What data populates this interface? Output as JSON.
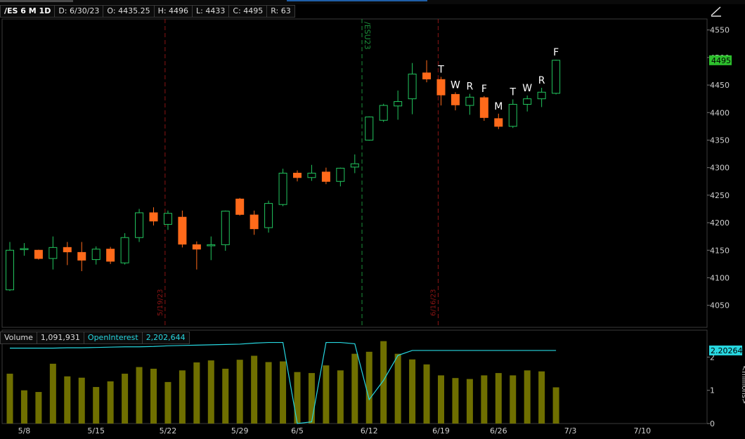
{
  "header": {
    "symbol": "/ES 6 M 1D",
    "date": "D: 6/30/23",
    "open": "O: 4435.25",
    "high": "H: 4496",
    "low": "L: 4433",
    "close": "C: 4495",
    "range": "R: 63"
  },
  "volume_header": {
    "volume_label": "Volume",
    "volume_value": "1,091,931",
    "oi_label": "OpenInterest",
    "oi_value": "2,202,644"
  },
  "colors": {
    "up": "#22c55e",
    "down": "#ff6a1a",
    "volume": "#6f6f00",
    "open_interest": "#27d7e0",
    "price_badge": "#2dc02d",
    "expiry_line": "#1b8f3a",
    "marker_line": "#8a1414"
  },
  "chart_data": [
    {
      "type": "candlestick",
      "ylim": [
        4010,
        4570
      ],
      "yticks": [
        4050,
        4100,
        4150,
        4200,
        4250,
        4300,
        4350,
        4400,
        4450,
        4500,
        4550
      ],
      "xticks": [
        {
          "label": "5/8",
          "index": 1
        },
        {
          "label": "5/15",
          "index": 6
        },
        {
          "label": "5/22",
          "index": 11
        },
        {
          "label": "5/29",
          "index": 16
        },
        {
          "label": "6/5",
          "index": 20
        },
        {
          "label": "6/12",
          "index": 25
        },
        {
          "label": "6/19",
          "index": 30
        },
        {
          "label": "6/26",
          "index": 34
        },
        {
          "label": "7/3",
          "index": 39
        },
        {
          "label": "7/10",
          "index": 44
        }
      ],
      "last_price": "4495",
      "candles": [
        {
          "i": 0,
          "o": 4078,
          "h": 4165,
          "l": 4076,
          "c": 4150
        },
        {
          "i": 1,
          "o": 4153,
          "h": 4163,
          "l": 4140,
          "c": 4153
        },
        {
          "i": 2,
          "o": 4150,
          "h": 4151,
          "l": 4133,
          "c": 4135
        },
        {
          "i": 3,
          "o": 4135,
          "h": 4175,
          "l": 4115,
          "c": 4155
        },
        {
          "i": 4,
          "o": 4155,
          "h": 4165,
          "l": 4123,
          "c": 4147
        },
        {
          "i": 5,
          "o": 4146,
          "h": 4165,
          "l": 4112,
          "c": 4132
        },
        {
          "i": 6,
          "o": 4133,
          "h": 4157,
          "l": 4124,
          "c": 4152
        },
        {
          "i": 7,
          "o": 4152,
          "h": 4156,
          "l": 4125,
          "c": 4130
        },
        {
          "i": 8,
          "o": 4127,
          "h": 4181,
          "l": 4124,
          "c": 4173
        },
        {
          "i": 9,
          "o": 4173,
          "h": 4225,
          "l": 4165,
          "c": 4218
        },
        {
          "i": 10,
          "o": 4218,
          "h": 4228,
          "l": 4195,
          "c": 4203
        },
        {
          "i": 11,
          "o": 4197,
          "h": 4222,
          "l": 4187,
          "c": 4217
        },
        {
          "i": 12,
          "o": 4210,
          "h": 4222,
          "l": 4155,
          "c": 4161
        },
        {
          "i": 13,
          "o": 4160,
          "h": 4166,
          "l": 4115,
          "c": 4152
        },
        {
          "i": 14,
          "o": 4158,
          "h": 4175,
          "l": 4132,
          "c": 4160
        },
        {
          "i": 15,
          "o": 4160,
          "h": 4222,
          "l": 4149,
          "c": 4221
        },
        {
          "i": 16,
          "o": 4243,
          "h": 4245,
          "l": 4213,
          "c": 4215
        },
        {
          "i": 17,
          "o": 4214,
          "h": 4222,
          "l": 4178,
          "c": 4189
        },
        {
          "i": 18,
          "o": 4191,
          "h": 4240,
          "l": 4182,
          "c": 4235
        },
        {
          "i": 19,
          "o": 4233,
          "h": 4298,
          "l": 4230,
          "c": 4290
        },
        {
          "i": 20,
          "o": 4290,
          "h": 4295,
          "l": 4275,
          "c": 4282
        },
        {
          "i": 21,
          "o": 4282,
          "h": 4305,
          "l": 4276,
          "c": 4290
        },
        {
          "i": 22,
          "o": 4292,
          "h": 4300,
          "l": 4270,
          "c": 4275
        },
        {
          "i": 23,
          "o": 4275,
          "h": 4300,
          "l": 4266,
          "c": 4299
        },
        {
          "i": 24,
          "o": 4301,
          "h": 4324,
          "l": 4290,
          "c": 4307
        },
        {
          "i": 25,
          "o": 4350,
          "h": 4393,
          "l": 4349,
          "c": 4392
        },
        {
          "i": 26,
          "o": 4386,
          "h": 4416,
          "l": 4383,
          "c": 4413
        },
        {
          "i": 27,
          "o": 4412,
          "h": 4440,
          "l": 4387,
          "c": 4420
        },
        {
          "i": 28,
          "o": 4425,
          "h": 4490,
          "l": 4397,
          "c": 4470
        },
        {
          "i": 29,
          "o": 4472,
          "h": 4495,
          "l": 4455,
          "c": 4461
        },
        {
          "i": 30,
          "o": 4460,
          "h": 4465,
          "l": 4413,
          "c": 4432
        },
        {
          "i": 31,
          "o": 4433,
          "h": 4437,
          "l": 4404,
          "c": 4414
        },
        {
          "i": 32,
          "o": 4413,
          "h": 4434,
          "l": 4396,
          "c": 4428
        },
        {
          "i": 33,
          "o": 4427,
          "h": 4430,
          "l": 4385,
          "c": 4391
        },
        {
          "i": 34,
          "o": 4389,
          "h": 4398,
          "l": 4370,
          "c": 4375
        },
        {
          "i": 35,
          "o": 4375,
          "h": 4424,
          "l": 4372,
          "c": 4415
        },
        {
          "i": 36,
          "o": 4415,
          "h": 4431,
          "l": 4402,
          "c": 4425
        },
        {
          "i": 37,
          "o": 4425,
          "h": 4445,
          "l": 4410,
          "c": 4437
        },
        {
          "i": 38,
          "o": 4435,
          "h": 4496,
          "l": 4433,
          "c": 4495
        }
      ],
      "annotations": [
        {
          "label": "T",
          "index": 30
        },
        {
          "label": "W",
          "index": 31
        },
        {
          "label": "R",
          "index": 32
        },
        {
          "label": "F",
          "index": 33
        },
        {
          "label": "M",
          "index": 34
        },
        {
          "label": "T",
          "index": 35
        },
        {
          "label": "W",
          "index": 36
        },
        {
          "label": "R",
          "index": 37
        },
        {
          "label": "F",
          "index": 38
        }
      ],
      "vertical_markers": [
        {
          "label": "5/19/23",
          "index": 10.8,
          "style": "date"
        },
        {
          "label": "/ESU23",
          "index": 24.5,
          "style": "expiry"
        },
        {
          "label": "6/16/23",
          "index": 29.8,
          "style": "date"
        }
      ]
    },
    {
      "type": "bar",
      "series_name": "Volume",
      "ylim_millions": [
        0,
        2.6
      ],
      "yticks": [
        0,
        1,
        2
      ],
      "y_axis_unit": "<millions>",
      "volumes_millions": [
        1.5,
        1.0,
        0.95,
        1.8,
        1.42,
        1.38,
        1.1,
        1.27,
        1.5,
        1.7,
        1.65,
        1.25,
        1.6,
        1.84,
        1.9,
        1.65,
        1.92,
        2.04,
        1.85,
        1.87,
        1.55,
        1.52,
        1.75,
        1.6,
        2.1,
        2.16,
        2.48,
        2.1,
        1.93,
        1.78,
        1.45,
        1.37,
        1.34,
        1.45,
        1.52,
        1.45,
        1.6,
        1.57,
        1.09
      ],
      "open_interest_millions": [
        2.27,
        2.27,
        2.27,
        2.27,
        2.28,
        2.28,
        2.29,
        2.3,
        2.31,
        2.31,
        2.32,
        2.34,
        2.35,
        2.36,
        2.37,
        2.38,
        2.39,
        2.42,
        2.44,
        2.44,
        0.0,
        0.05,
        2.44,
        2.44,
        2.4,
        0.72,
        1.3,
        2.05,
        2.2,
        2.2,
        2.2,
        2.2,
        2.2,
        2.2,
        2.2,
        2.2,
        2.2,
        2.2,
        2.2
      ],
      "last_oi_label": "2.20264"
    }
  ]
}
